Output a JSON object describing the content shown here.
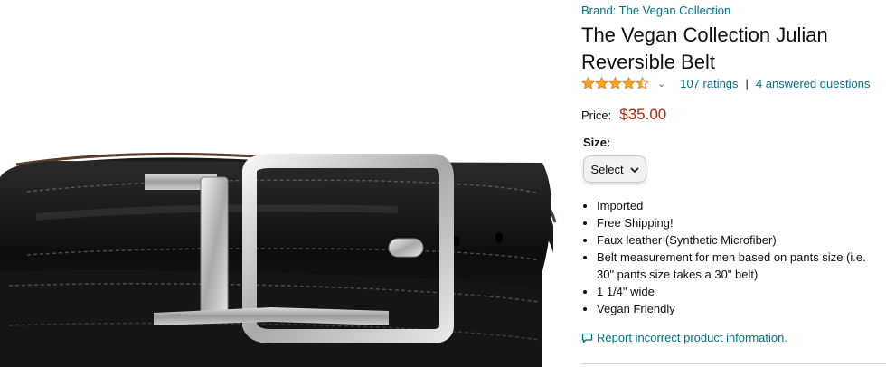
{
  "product": {
    "brand": "Brand: The Vegan Collection",
    "title": "The Vegan Collection Julian Reversible Belt",
    "rating_stars": 4.5,
    "ratings_count": "107 ratings",
    "separator": "|",
    "answered_questions": "4 answered questions",
    "price_label": "Price:",
    "price": "$35.00",
    "size_label": "Size:",
    "size_selected": "Select",
    "bullets": [
      "Imported",
      "Free Shipping!",
      "Faux leather (Synthetic Microfiber)",
      "Belt measurement for men based on pants size (i.e. 30\" pants size takes a 30\" belt)",
      "1 1/4\" wide",
      "Vegan Friendly"
    ],
    "report_link": "Report incorrect product information."
  },
  "colors": {
    "link": "#007185",
    "price": "#b12704",
    "star": "#ffa41c",
    "text": "#0f1111"
  },
  "icons": {
    "rating": "star-icon",
    "dropdown": "chevron-down-icon",
    "report": "speech-bubble-icon"
  }
}
